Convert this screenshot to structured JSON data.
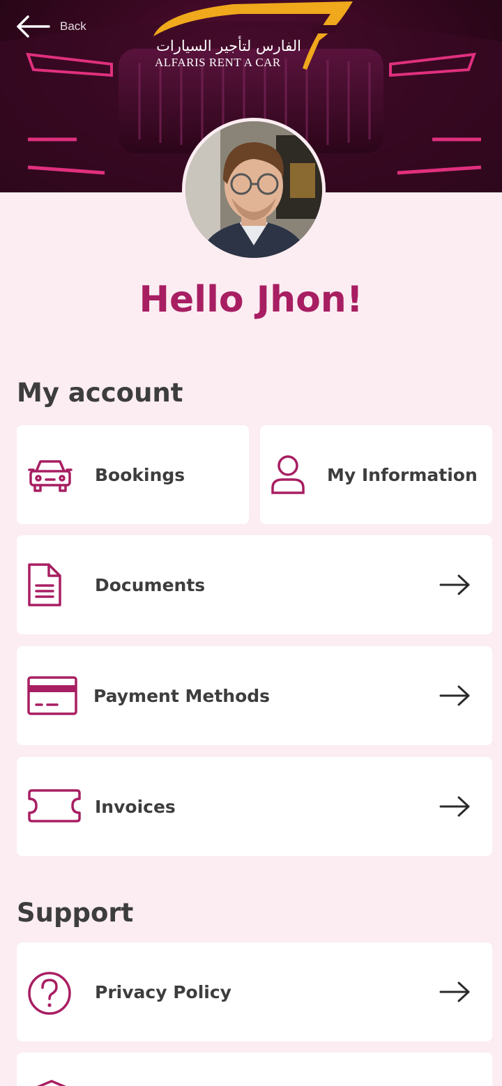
{
  "header": {
    "back_label": "Back",
    "logo_arabic": "الفارس لتأجير السيارات",
    "logo_english": "ALFARIS RENT A CAR"
  },
  "greeting": "Hello Jhon!",
  "sections": {
    "account": {
      "title": "My account",
      "items": {
        "bookings": "Bookings",
        "my_information": "My Information",
        "documents": "Documents",
        "payment_methods": "Payment Methods",
        "invoices": "Invoices"
      }
    },
    "support": {
      "title": "Support",
      "items": {
        "privacy_policy": "Privacy Policy"
      }
    }
  },
  "colors": {
    "accent": "#a81e62",
    "background": "#fbedf2",
    "card": "#ffffff",
    "logo_gold": "#f0a81c"
  },
  "icons": [
    "arrow-left-icon",
    "car-icon",
    "user-icon",
    "document-icon",
    "credit-card-icon",
    "ticket-icon",
    "question-circle-icon",
    "arrow-right-icon",
    "shield-icon"
  ]
}
